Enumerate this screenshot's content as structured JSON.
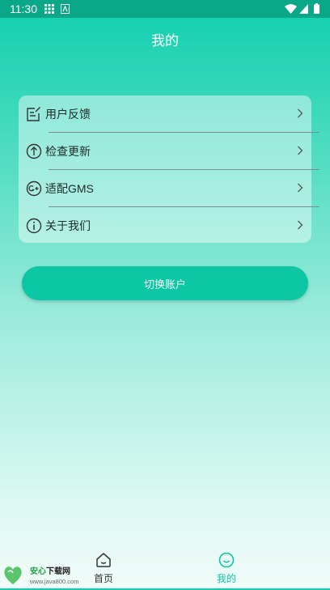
{
  "status_bar": {
    "time": "11:30"
  },
  "header": {
    "title": "我的"
  },
  "menu": {
    "items": [
      {
        "label": "用户反馈",
        "icon": "edit-note-icon"
      },
      {
        "label": "检查更新",
        "icon": "upload-arrow-icon"
      },
      {
        "label": "适配GMS",
        "icon": "google-plus-icon"
      },
      {
        "label": "关于我们",
        "icon": "info-icon"
      }
    ]
  },
  "switch_account": {
    "label": "切换账户"
  },
  "bottom_nav": {
    "tabs": [
      {
        "label": "首页",
        "icon": "home-icon",
        "active": false,
        "color": "#333333"
      },
      {
        "label": "我的",
        "icon": "smile-face-icon",
        "active": true,
        "color": "#0cc7a3"
      }
    ]
  },
  "watermark": {
    "brand": "安心下载网",
    "url": "www.java800.com"
  },
  "colors": {
    "accent": "#0cc7a3",
    "status_bar": "#0aa888"
  }
}
